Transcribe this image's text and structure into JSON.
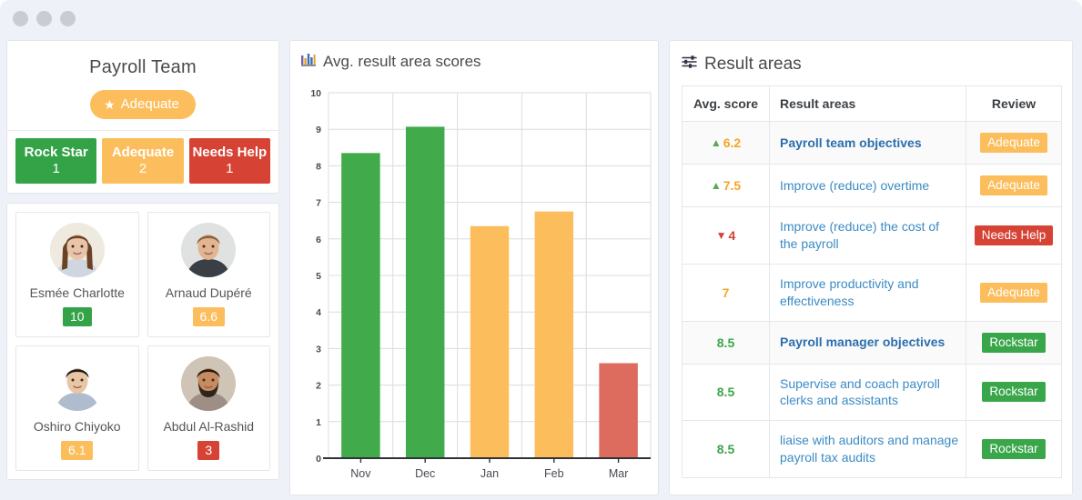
{
  "window": {
    "dots": [
      "close-dot",
      "minimize-dot",
      "maximize-dot"
    ]
  },
  "colors": {
    "green": "#41ab4b",
    "green_alt": "#3aa64a",
    "amber": "#fcbe5c",
    "amber_text": "#f5a623",
    "red": "#d64335",
    "red_bar": "#dd6b5e",
    "link_blue": "#3b8bc4",
    "bg": "#eef1f8"
  },
  "team": {
    "title": "Payroll Team",
    "badge_label": "Adequate",
    "badge_icon": "star-icon",
    "scores": [
      {
        "label": "Rock Star",
        "count": "1",
        "color": "#34a347"
      },
      {
        "label": "Adequate",
        "count": "2",
        "color": "#fcbe5c"
      },
      {
        "label": "Needs Help",
        "count": "1",
        "color": "#d64335"
      }
    ]
  },
  "people": [
    {
      "name": "Esmée Charlotte",
      "score": "10",
      "score_color": "#34a347",
      "avatar": "avatar-esmee"
    },
    {
      "name": "Arnaud Dupéré",
      "score": "6.6",
      "score_color": "#fcbe5c",
      "avatar": "avatar-arnaud"
    },
    {
      "name": "Oshiro Chiyoko",
      "score": "6.1",
      "score_color": "#fcbe5c",
      "avatar": "avatar-oshiro"
    },
    {
      "name": "Abdul Al-Rashid",
      "score": "3",
      "score_color": "#d64335",
      "avatar": "avatar-abdul"
    }
  ],
  "chart_panel": {
    "title": "Avg. result area scores",
    "icon": "bar-chart-icon"
  },
  "chart_data": {
    "type": "bar",
    "title": "Avg. result area scores",
    "xlabel": "",
    "ylabel": "",
    "categories": [
      "Nov",
      "Dec",
      "Jan",
      "Feb",
      "Mar"
    ],
    "values": [
      8.35,
      9.07,
      6.35,
      6.75,
      2.6
    ],
    "bar_colors": [
      "#41ab4b",
      "#41ab4b",
      "#fcbe5c",
      "#fcbe5c",
      "#dd6b5e"
    ],
    "ylim": [
      0,
      10
    ],
    "yticks": [
      "0",
      "1",
      "2",
      "3",
      "4",
      "5",
      "6",
      "7",
      "8",
      "9",
      "10"
    ],
    "grid": true,
    "legend": "none"
  },
  "result_panel": {
    "title": "Result areas",
    "icon": "sliders-icon",
    "columns": [
      "Avg. score",
      "Result areas",
      "Review"
    ],
    "rows": [
      {
        "score": "6.2",
        "trend": "up",
        "area": "Payroll team objectives",
        "bold": true,
        "shaded": true,
        "review": "Adequate",
        "review_color": "#fcbe5c",
        "score_color": "#f5a623"
      },
      {
        "score": "7.5",
        "trend": "up",
        "area": "Improve (reduce) overtime",
        "bold": false,
        "shaded": false,
        "review": "Adequate",
        "review_color": "#fcbe5c",
        "score_color": "#f5a623"
      },
      {
        "score": "4",
        "trend": "down",
        "area": "Improve (reduce) the cost of the payroll",
        "bold": false,
        "shaded": false,
        "review": "Needs Help",
        "review_color": "#d64335",
        "score_color": "#d64335"
      },
      {
        "score": "7",
        "trend": "none",
        "area": "Improve productivity and effectiveness",
        "bold": false,
        "shaded": false,
        "review": "Adequate",
        "review_color": "#fcbe5c",
        "score_color": "#f5a623"
      },
      {
        "score": "8.5",
        "trend": "none",
        "area": "Payroll manager objectives",
        "bold": true,
        "shaded": true,
        "review": "Rockstar",
        "review_color": "#3aa64a",
        "score_color": "#3aa64a"
      },
      {
        "score": "8.5",
        "trend": "none",
        "area": "Supervise and coach payroll clerks and assistants",
        "bold": false,
        "shaded": false,
        "review": "Rockstar",
        "review_color": "#3aa64a",
        "score_color": "#3aa64a"
      },
      {
        "score": "8.5",
        "trend": "none",
        "area": "liaise with auditors and manage payroll tax audits",
        "bold": false,
        "shaded": false,
        "review": "Rockstar",
        "review_color": "#3aa64a",
        "score_color": "#3aa64a"
      }
    ]
  }
}
